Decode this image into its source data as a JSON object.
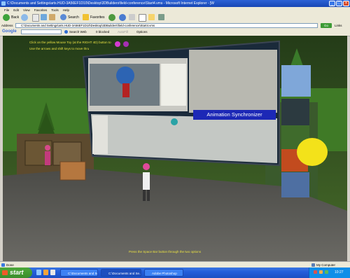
{
  "window": {
    "title": "C:\\Documents and Settings\\arts.HUD-3A56EF1D10\\Desktop\\3DBuilders\\field-conference\\Start4.vms - Microsoft Internet Explorer - [W"
  },
  "menu": [
    "File",
    "Edit",
    "View",
    "Favorites",
    "Tools",
    "Help"
  ],
  "toolbar": {
    "back_label": "Back",
    "search_label": "Search",
    "favorites_label": "Favorites"
  },
  "address": {
    "label": "Address",
    "value": "C:\\Documents and Settings\\arts.HUD-3A56EF1D10\\Desktop\\3DBuilders\\field-conference\\Start4.vms",
    "go_label": "Go",
    "links_label": "Links"
  },
  "google": {
    "label": "Google",
    "search_web": "Search Web",
    "blocked": "0 blocked",
    "autofill": "AutoFill",
    "options": "Options"
  },
  "scene": {
    "instruction_top_1": "Click on the yellow Mouse Toy (at the RIGHT 4D) button to",
    "instruction_top_2": "Use the arrows and shift keys to move thru",
    "animation_label": "Animation Synchronizer",
    "instruction_bottom": "Press the Space Bar button through the two options"
  },
  "statusbar": {
    "done": "Done",
    "zone": "My Computer"
  },
  "taskbar": {
    "start": "start",
    "tasks": [
      "C:\\Documents and Se...",
      "C:\\Documents and Se...",
      "Adobe Photoshop"
    ],
    "clock": "10:27"
  }
}
